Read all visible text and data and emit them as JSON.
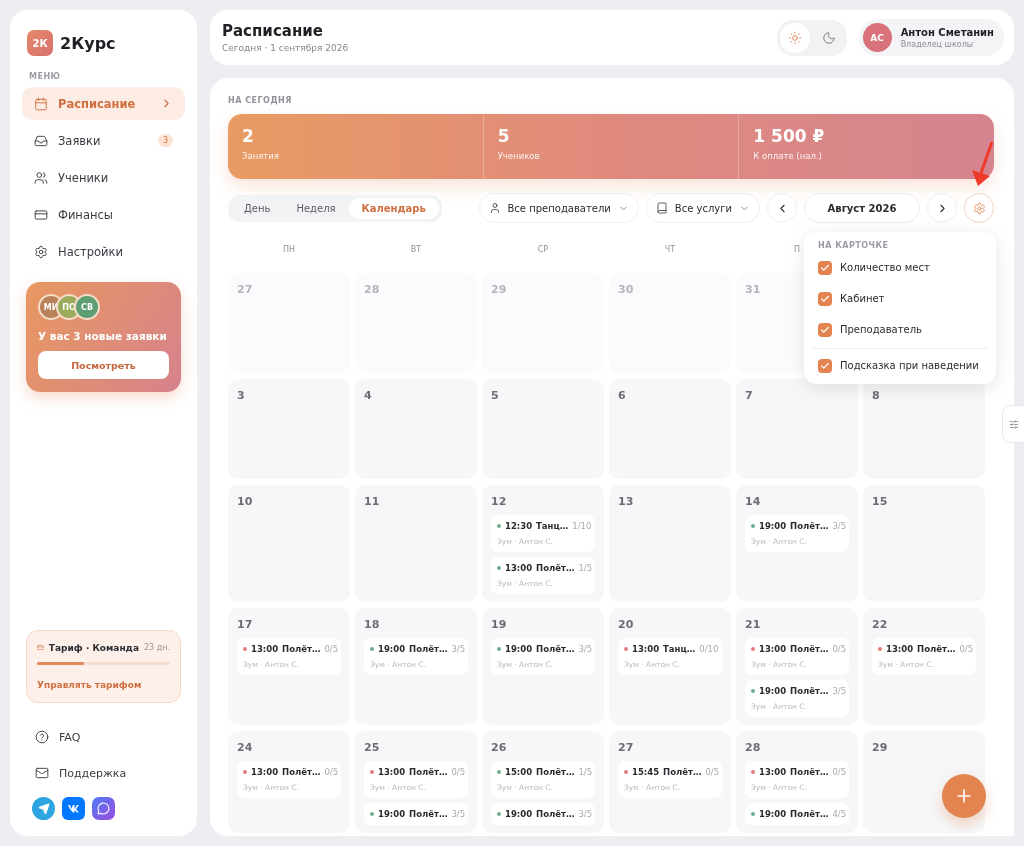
{
  "sidebar": {
    "logo_mark": "2К",
    "brand": "2Курс",
    "menu_label": "МЕНЮ",
    "items": [
      {
        "label": "Расписание",
        "selected": true
      },
      {
        "label": "Заявки",
        "selected": false,
        "badge": "3"
      },
      {
        "label": "Ученики",
        "selected": false
      },
      {
        "label": "Финансы",
        "selected": false
      },
      {
        "label": "Настройки",
        "selected": false
      }
    ],
    "promo": {
      "avatars": [
        {
          "initials": "МИ",
          "color": "#b9825a"
        },
        {
          "initials": "ПО",
          "color": "#9aab5c"
        },
        {
          "initials": "СВ",
          "color": "#5f9e73"
        }
      ],
      "text": "У вас 3 новые заявки",
      "button": "Посмотреть"
    },
    "plan": {
      "title": "Тариф · Команда",
      "days": "23 дн.",
      "level": 0.35,
      "link": "Управлять тарифом"
    },
    "footer": [
      {
        "label": "FAQ"
      },
      {
        "label": "Поддержка"
      }
    ],
    "socials": [
      {
        "kind": "telegram"
      },
      {
        "kind": "vk"
      },
      {
        "kind": "max"
      }
    ]
  },
  "header": {
    "title": "Расписание",
    "subtitle": "Сегодня · 1 сентября 2026",
    "theme": [
      {
        "kind": "light",
        "selected": true
      },
      {
        "kind": "dark",
        "selected": false
      }
    ],
    "user": {
      "initials": "АС",
      "name": "Антон Сметанин",
      "role": "Владелец школы"
    }
  },
  "today": {
    "label": "НА СЕГОДНЯ",
    "stats": [
      {
        "value": "2",
        "label": "Занятия"
      },
      {
        "value": "5",
        "label": "Учеников"
      },
      {
        "value": "1 500 ₽",
        "label": "К оплате (нал.)"
      }
    ]
  },
  "views": [
    {
      "label": "День",
      "selected": false
    },
    {
      "label": "Неделя",
      "selected": false
    },
    {
      "label": "Календарь",
      "selected": true
    }
  ],
  "filters": [
    {
      "label": "Все преподаватели"
    },
    {
      "label": "Все услуги"
    }
  ],
  "month": "Август 2026",
  "weekdays": [
    "ПН",
    "ВТ",
    "СР",
    "ЧТ",
    "П"
  ],
  "weeks": [
    {
      "days": [
        {
          "day": "27",
          "muted": true
        },
        {
          "day": "28",
          "muted": true
        },
        {
          "day": "29",
          "muted": true
        },
        {
          "day": "30",
          "muted": true
        },
        {
          "day": "31",
          "muted": true
        }
      ]
    },
    {
      "days": [
        {
          "day": "3",
          "muted": false
        },
        {
          "day": "4",
          "muted": false
        },
        {
          "day": "5",
          "muted": false
        },
        {
          "day": "6",
          "muted": false
        },
        {
          "day": "7",
          "muted": false
        },
        {
          "day": "8",
          "muted": false
        }
      ]
    },
    {
      "days": [
        {
          "day": "10",
          "muted": false
        },
        {
          "day": "11",
          "muted": false
        },
        {
          "day": "12",
          "muted": false,
          "events": [
            {
              "color": "#6fae8c",
              "time": "12:30",
              "title": "Танц…",
              "seats": "1/10",
              "info": "Зум · Антон С."
            },
            {
              "color": "#6fae8c",
              "time": "13:00",
              "title": "Полёт…",
              "seats": "1/5",
              "info": "Зум · Антон С."
            }
          ]
        },
        {
          "day": "13",
          "muted": false
        },
        {
          "day": "14",
          "muted": false,
          "events": [
            {
              "color": "#6fae8c",
              "time": "19:00",
              "title": "Полёт…",
              "seats": "3/5",
              "info": "Зум · Антон С."
            }
          ]
        },
        {
          "day": "15",
          "muted": false
        }
      ]
    },
    {
      "days": [
        {
          "day": "17",
          "muted": false,
          "events": [
            {
              "color": "#e07c7c",
              "time": "13:00",
              "title": "Полёт…",
              "seats": "0/5",
              "info": "Зум · Антон С."
            }
          ]
        },
        {
          "day": "18",
          "muted": false,
          "events": [
            {
              "color": "#6fae8c",
              "time": "19:00",
              "title": "Полёт…",
              "seats": "3/5",
              "info": "Зум · Антон С."
            }
          ]
        },
        {
          "day": "19",
          "muted": false,
          "events": [
            {
              "color": "#6fae8c",
              "time": "19:00",
              "title": "Полёт…",
              "seats": "3/5",
              "info": "Зум · Антон С."
            }
          ]
        },
        {
          "day": "20",
          "muted": false,
          "events": [
            {
              "color": "#e07c7c",
              "time": "13:00",
              "title": "Танц…",
              "seats": "0/10",
              "info": "Зум · Антон С."
            }
          ]
        },
        {
          "day": "21",
          "muted": false,
          "events": [
            {
              "color": "#e07c7c",
              "time": "13:00",
              "title": "Полёт…",
              "seats": "0/5",
              "info": "Зум · Антон С."
            },
            {
              "color": "#6fae8c",
              "time": "19:00",
              "title": "Полёт…",
              "seats": "3/5",
              "info": "Зум · Антон С."
            }
          ]
        },
        {
          "day": "22",
          "muted": false,
          "events": [
            {
              "color": "#e07c7c",
              "time": "13:00",
              "title": "Полёт…",
              "seats": "0/5",
              "info": "Зум · Антон С."
            }
          ]
        }
      ]
    },
    {
      "days": [
        {
          "day": "24",
          "muted": false,
          "events": [
            {
              "color": "#e07c7c",
              "time": "13:00",
              "title": "Полёт…",
              "seats": "0/5",
              "info": "Зум · Антон С."
            }
          ]
        },
        {
          "day": "25",
          "muted": false,
          "events": [
            {
              "color": "#e07c7c",
              "time": "13:00",
              "title": "Полёт…",
              "seats": "0/5",
              "info": "Зум · Антон С."
            },
            {
              "color": "#6fae8c",
              "time": "19:00",
              "title": "Полёт…",
              "seats": "3/5"
            }
          ]
        },
        {
          "day": "26",
          "muted": false,
          "events": [
            {
              "color": "#6fae8c",
              "time": "15:00",
              "title": "Полёт…",
              "seats": "1/5",
              "info": "Зум · Антон С."
            },
            {
              "color": "#6fae8c",
              "time": "19:00",
              "title": "Полёт…",
              "seats": "3/5"
            }
          ]
        },
        {
          "day": "27",
          "muted": false,
          "events": [
            {
              "color": "#e07c7c",
              "time": "15:45",
              "title": "Полёт…",
              "seats": "0/5",
              "info": "Зум · Антон С."
            }
          ]
        },
        {
          "day": "28",
          "muted": false,
          "events": [
            {
              "color": "#e07c7c",
              "time": "13:00",
              "title": "Полёт…",
              "seats": "0/5",
              "info": "Зум · Антон С."
            },
            {
              "color": "#6fae8c",
              "time": "19:00",
              "title": "Полёт…",
              "seats": "4/5"
            }
          ]
        },
        {
          "day": "29",
          "muted": false
        }
      ]
    }
  ],
  "card_settings": {
    "label": "НА КАРТОЧКЕ",
    "options": [
      {
        "label": "Количество мест",
        "checked": true
      },
      {
        "label": "Кабинет",
        "checked": true
      },
      {
        "label": "Преподаватель",
        "checked": true
      },
      {
        "label": "Подсказка при наведении",
        "checked": true,
        "separated": true
      }
    ]
  }
}
